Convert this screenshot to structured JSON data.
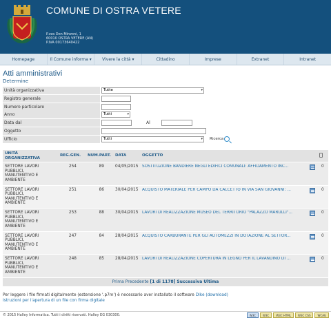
{
  "header": {
    "title": "COMUNE DI OSTRA VETERE",
    "address_lines": [
      "P.zza Don Minzoni, 1",
      "60010 OSTRA VETERE (AN)",
      "P.IVA 00173640422"
    ]
  },
  "nav": [
    "Homepage",
    "Il Comune informa ▾",
    "Vivere la città ▾",
    "Cittadino",
    "Imprese",
    "Extranet",
    "Intranet"
  ],
  "page": {
    "title": "Atti amministrativi",
    "subtitle": "Determine"
  },
  "form": {
    "unita_label": "Unità organizzativa",
    "unita_value": "Tutte",
    "registro_label": "Registro generale",
    "numero_label": "Numero particolare",
    "anno_label": "Anno",
    "anno_value": "Tutti",
    "data_dal_label": "Data dal",
    "al_label": "Al",
    "oggetto_label": "Oggetto",
    "ufficio_label": "Ufficio",
    "ufficio_value": "Tutti",
    "search_label": "Ricerca"
  },
  "table": {
    "headers": {
      "uo": "UNITÀ ORGANIZZATIVA",
      "reg": "REG.GEN.",
      "num": "NUM.PART.",
      "date": "DATA",
      "obj": "OGGETTO"
    },
    "rows": [
      {
        "uo": "SETTORE LAVORI PUBBLICI, MANUTENTIVO E AMBIENTE",
        "reg": "254",
        "num": "89",
        "date": "04/05/2015",
        "obj": "SOSTITUZIONE BANDIERE NEGLI EDIFICI COMUNALI: AFFIDAMENTO INC...",
        "cnt": "0"
      },
      {
        "uo": "SETTORE LAVORI PUBBLICI, MANUTENTIVO E AMBIENTE",
        "reg": "251",
        "num": "86",
        "date": "30/04/2015",
        "obj": "ACQUISTO MATERIALE PER CAMPO DA CALCETTO IN VIA SAN GIOVANNI: ...",
        "cnt": "0"
      },
      {
        "uo": "SETTORE LAVORI PUBBLICI, MANUTENTIVO E AMBIENTE",
        "reg": "253",
        "num": "88",
        "date": "30/04/2015",
        "obj": "LAVORI DI REALIZZAZIONE MUSEO DEL TERRITORIO \"PALAZZO MARULLI\"...",
        "cnt": "0"
      },
      {
        "uo": "SETTORE LAVORI PUBBLICI, MANUTENTIVO E AMBIENTE",
        "reg": "247",
        "num": "84",
        "date": "28/04/2015",
        "obj": "ACQUISTO CARBURANTE PER GLI AUTOMEZZI IN DOTAZIONE AL SETTOR...",
        "cnt": "0"
      },
      {
        "uo": "SETTORE LAVORI PUBBLICI, MANUTENTIVO E AMBIENTE",
        "reg": "248",
        "num": "85",
        "date": "28/04/2015",
        "obj": "LAVORI DI REALIZZAZIONE COPERTURA IN LEGNO PER IL LAVANDINO DI ...",
        "cnt": "0"
      }
    ]
  },
  "pager": {
    "first": "Prima",
    "prev": "Precedente",
    "info": "[1 di 1178]",
    "next": "Successiva",
    "last": "Ultima"
  },
  "note": {
    "text": "Per leggere i file firmati digitalmente (estensione '.p7m') è necessario aver installato il software",
    "dike_link": "Dike (download)",
    "instructions_link": "Istruzioni per l'apertura di un file con firma digitale"
  },
  "footer": {
    "copyright": "© 2015 Halley Informatica. Tutti i diritti riservati. Halley EG 030300.",
    "badges": [
      "W3C",
      "W3C",
      "W3C HTML",
      "W3C CSS",
      "WCAG"
    ]
  },
  "colors": {
    "header_bg": "#14507d",
    "link": "#1f6ea8",
    "title": "#1f5a88"
  }
}
